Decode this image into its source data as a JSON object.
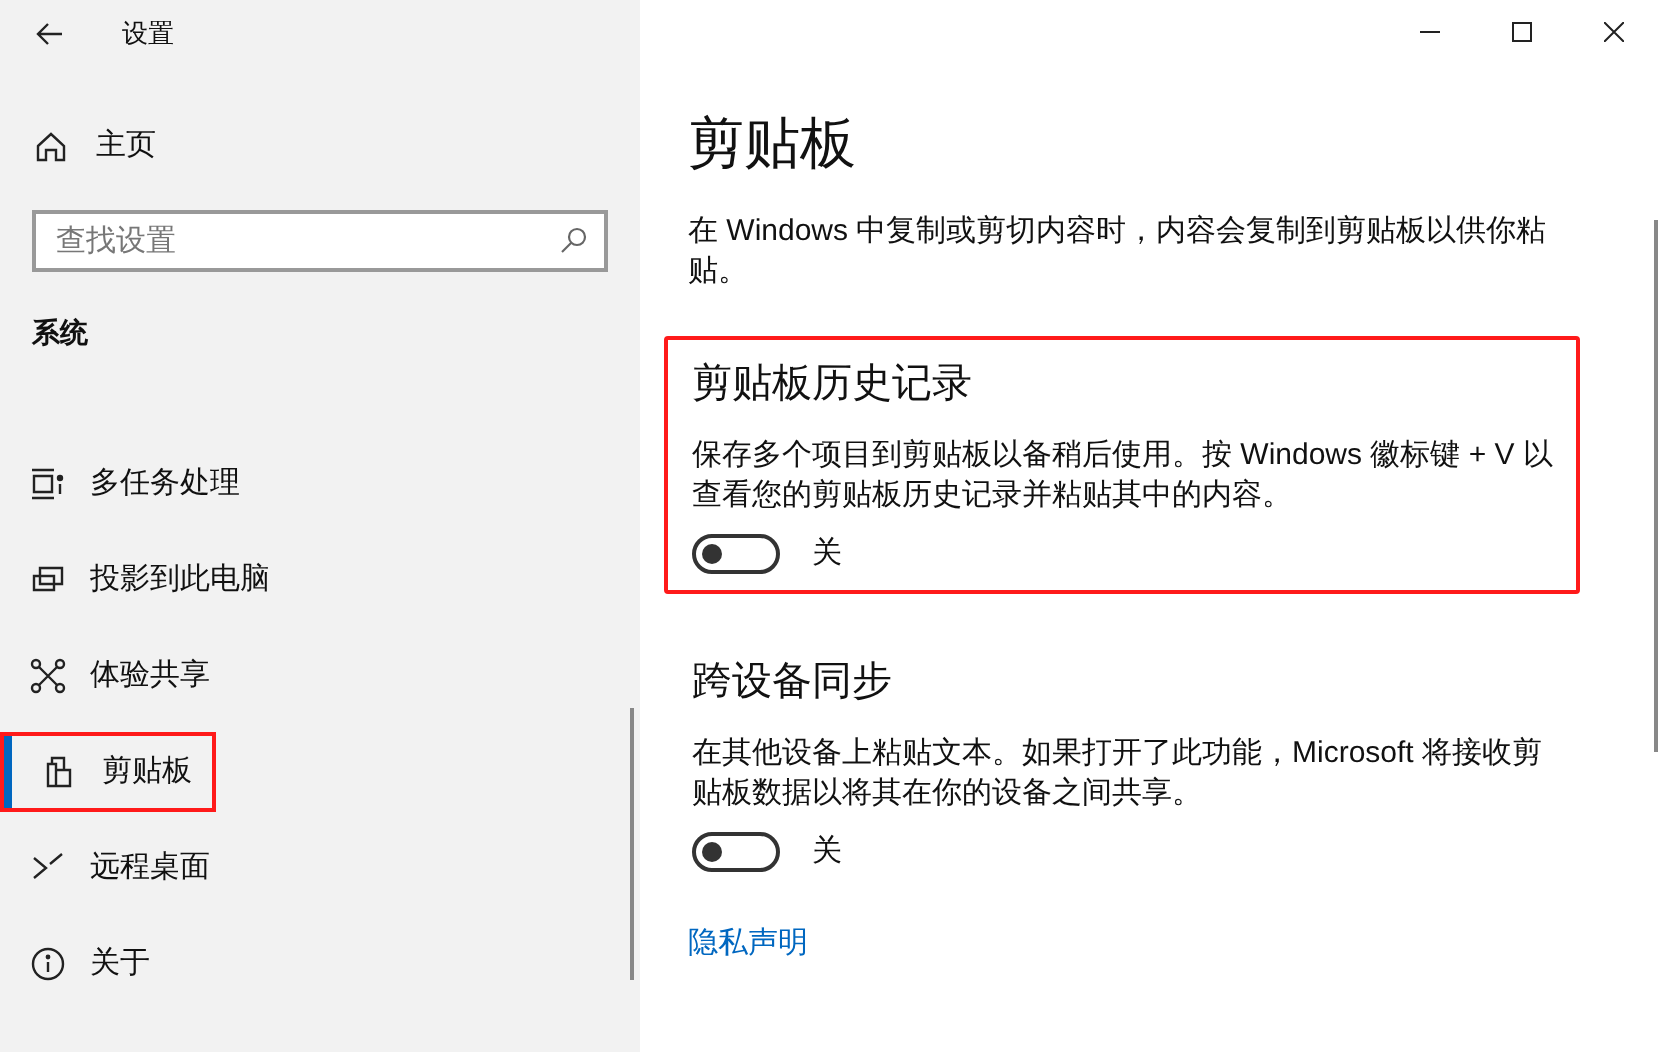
{
  "window": {
    "title": "设置"
  },
  "sidebar": {
    "home": "主页",
    "search": {
      "placeholder": "查找设置"
    },
    "group": "系统",
    "items": [
      {
        "label": "多任务处理",
        "kind": "multitask",
        "selected": false,
        "highlighted": false
      },
      {
        "label": "投影到此电脑",
        "kind": "project",
        "selected": false,
        "highlighted": false
      },
      {
        "label": "体验共享",
        "kind": "share",
        "selected": false,
        "highlighted": false
      },
      {
        "label": "剪贴板",
        "kind": "clipboard",
        "selected": true,
        "highlighted": true
      },
      {
        "label": "远程桌面",
        "kind": "remote",
        "selected": false,
        "highlighted": false
      },
      {
        "label": "关于",
        "kind": "info",
        "selected": false,
        "highlighted": false
      }
    ]
  },
  "page": {
    "title": "剪贴板",
    "description": "在 Windows 中复制或剪切内容时，内容会复制到剪贴板以供你粘贴。",
    "sections": [
      {
        "title": "剪贴板历史记录",
        "description": "保存多个项目到剪贴板以备稍后使用。按 Windows 徽标键 + V 以查看您的剪贴板历史记录并粘贴其中的内容。",
        "toggle": {
          "on": false,
          "label": "关"
        },
        "highlighted": true
      },
      {
        "title": "跨设备同步",
        "description": "在其他设备上粘贴文本。如果打开了此功能，Microsoft 将接收剪贴板数据以将其在你的设备之间共享。",
        "toggle": {
          "on": false,
          "label": "关"
        },
        "highlighted": false
      }
    ],
    "link": "隐私声明"
  }
}
